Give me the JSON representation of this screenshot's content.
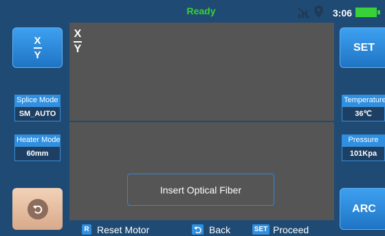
{
  "status": {
    "text": "Ready",
    "time": "3:06",
    "battery_level": 1.0,
    "status_color": "#39d139"
  },
  "left_panel": {
    "xy_button": {
      "top": "X",
      "bottom": "Y"
    },
    "splice_mode": {
      "label": "Splice Mode",
      "value": "SM_AUTO"
    },
    "heater_mode": {
      "label": "Heater Mode",
      "value": "60mm"
    }
  },
  "right_panel": {
    "set_label": "SET",
    "temperature": {
      "label": "Temperature",
      "value": "36℃"
    },
    "pressure": {
      "label": "Pressure",
      "value": "101Kpa"
    },
    "arc_label": "ARC"
  },
  "view": {
    "axis_top": "X",
    "axis_bottom": "Y",
    "message": "Insert Optical Fiber"
  },
  "footer": {
    "reset": {
      "key": "R",
      "label": "Reset Motor"
    },
    "back": {
      "label": "Back"
    },
    "proceed": {
      "key": "SET",
      "label": "Proceed"
    }
  },
  "colors": {
    "accent": "#2f8fe0",
    "background": "#1f4a73",
    "view_bg": "#555555",
    "return_button": "#e8bfa3"
  }
}
